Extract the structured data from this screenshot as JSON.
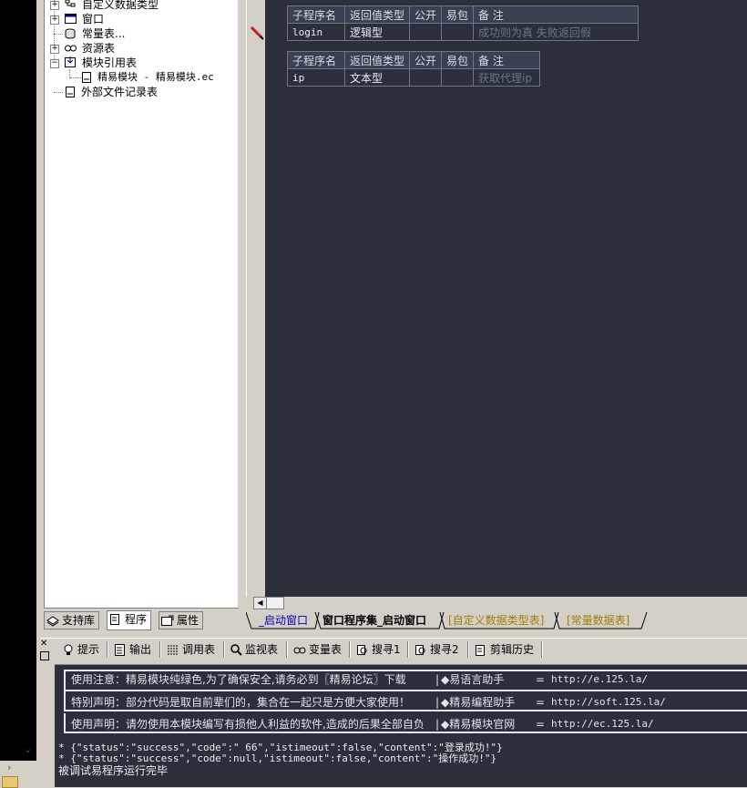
{
  "tree": {
    "items": [
      {
        "label": "自定义数据类型"
      },
      {
        "label": "窗口"
      },
      {
        "label": "常量表..."
      },
      {
        "label": "资源表"
      },
      {
        "label": "模块引用表"
      },
      {
        "label": "精易模块 - 精易模块.ec"
      },
      {
        "label": "外部文件记录表"
      }
    ]
  },
  "left_tabs": [
    {
      "label": "支持库"
    },
    {
      "label": "程序"
    },
    {
      "label": "属性"
    }
  ],
  "subprograms": [
    {
      "headers": [
        "子程序名",
        "返回值类型",
        "公开",
        "易包",
        "备 注"
      ],
      "name": "login",
      "return_type": "逻辑型",
      "public": "",
      "epackage": "",
      "remark": "成功则为真 失败返回假"
    },
    {
      "headers": [
        "子程序名",
        "返回值类型",
        "公开",
        "易包",
        "备 注"
      ],
      "name": "ip",
      "return_type": "文本型",
      "public": "",
      "epackage": "",
      "remark": "获取代理ip"
    }
  ],
  "editor_tabs": [
    {
      "label": "_启动窗口",
      "color": "#0000c0"
    },
    {
      "label": "窗口程序集_启动窗口",
      "color": "#000000"
    },
    {
      "label": "[自定义数据类型表]",
      "color": "#a08000"
    },
    {
      "label": "[常量数据表]",
      "color": "#a08000"
    }
  ],
  "output_tabs": [
    {
      "label": "提示",
      "icon": "lightbulb-icon"
    },
    {
      "label": "输出",
      "icon": "output-icon"
    },
    {
      "label": "调用表",
      "icon": "call-table-icon"
    },
    {
      "label": "监视表",
      "icon": "magnifier-icon"
    },
    {
      "label": "变量表",
      "icon": "variable-icon"
    },
    {
      "label": "搜寻1",
      "icon": "search1-icon"
    },
    {
      "label": "搜寻2",
      "icon": "search2-icon"
    },
    {
      "label": "剪辑历史",
      "icon": "clipboard-icon"
    }
  ],
  "notices": [
    {
      "text": "使用注意：精易模块纯绿色,为了确保安全,请务必到〖精易论坛〗下载",
      "link_label": "◆易语言助手",
      "link_url": "http://e.125.la/"
    },
    {
      "text": "特别声明：部分代码是取自前辈们的，集合在一起只是方便大家使用！",
      "link_label": "◆精易编程助手",
      "link_url": "http://soft.125.la/"
    },
    {
      "text": "使用声明：请勿使用本模块编写有损他人利益的软件,造成的后果全部自负",
      "link_label": "◆精易模块官网",
      "link_url": "http://ec.125.la/"
    }
  ],
  "output_lines": [
    "* {\"status\":\"success\",\"code\":\"   66\",\"istimeout\":false,\"content\":\"登录成功!\"}",
    "* {\"status\":\"success\",\"code\":null,\"istimeout\":false,\"content\":\"操作成功!\"}",
    "被调试易程序运行完毕"
  ],
  "colors": {
    "editor_bg": "#2b2f3a",
    "breakpoint": "#c02020"
  }
}
